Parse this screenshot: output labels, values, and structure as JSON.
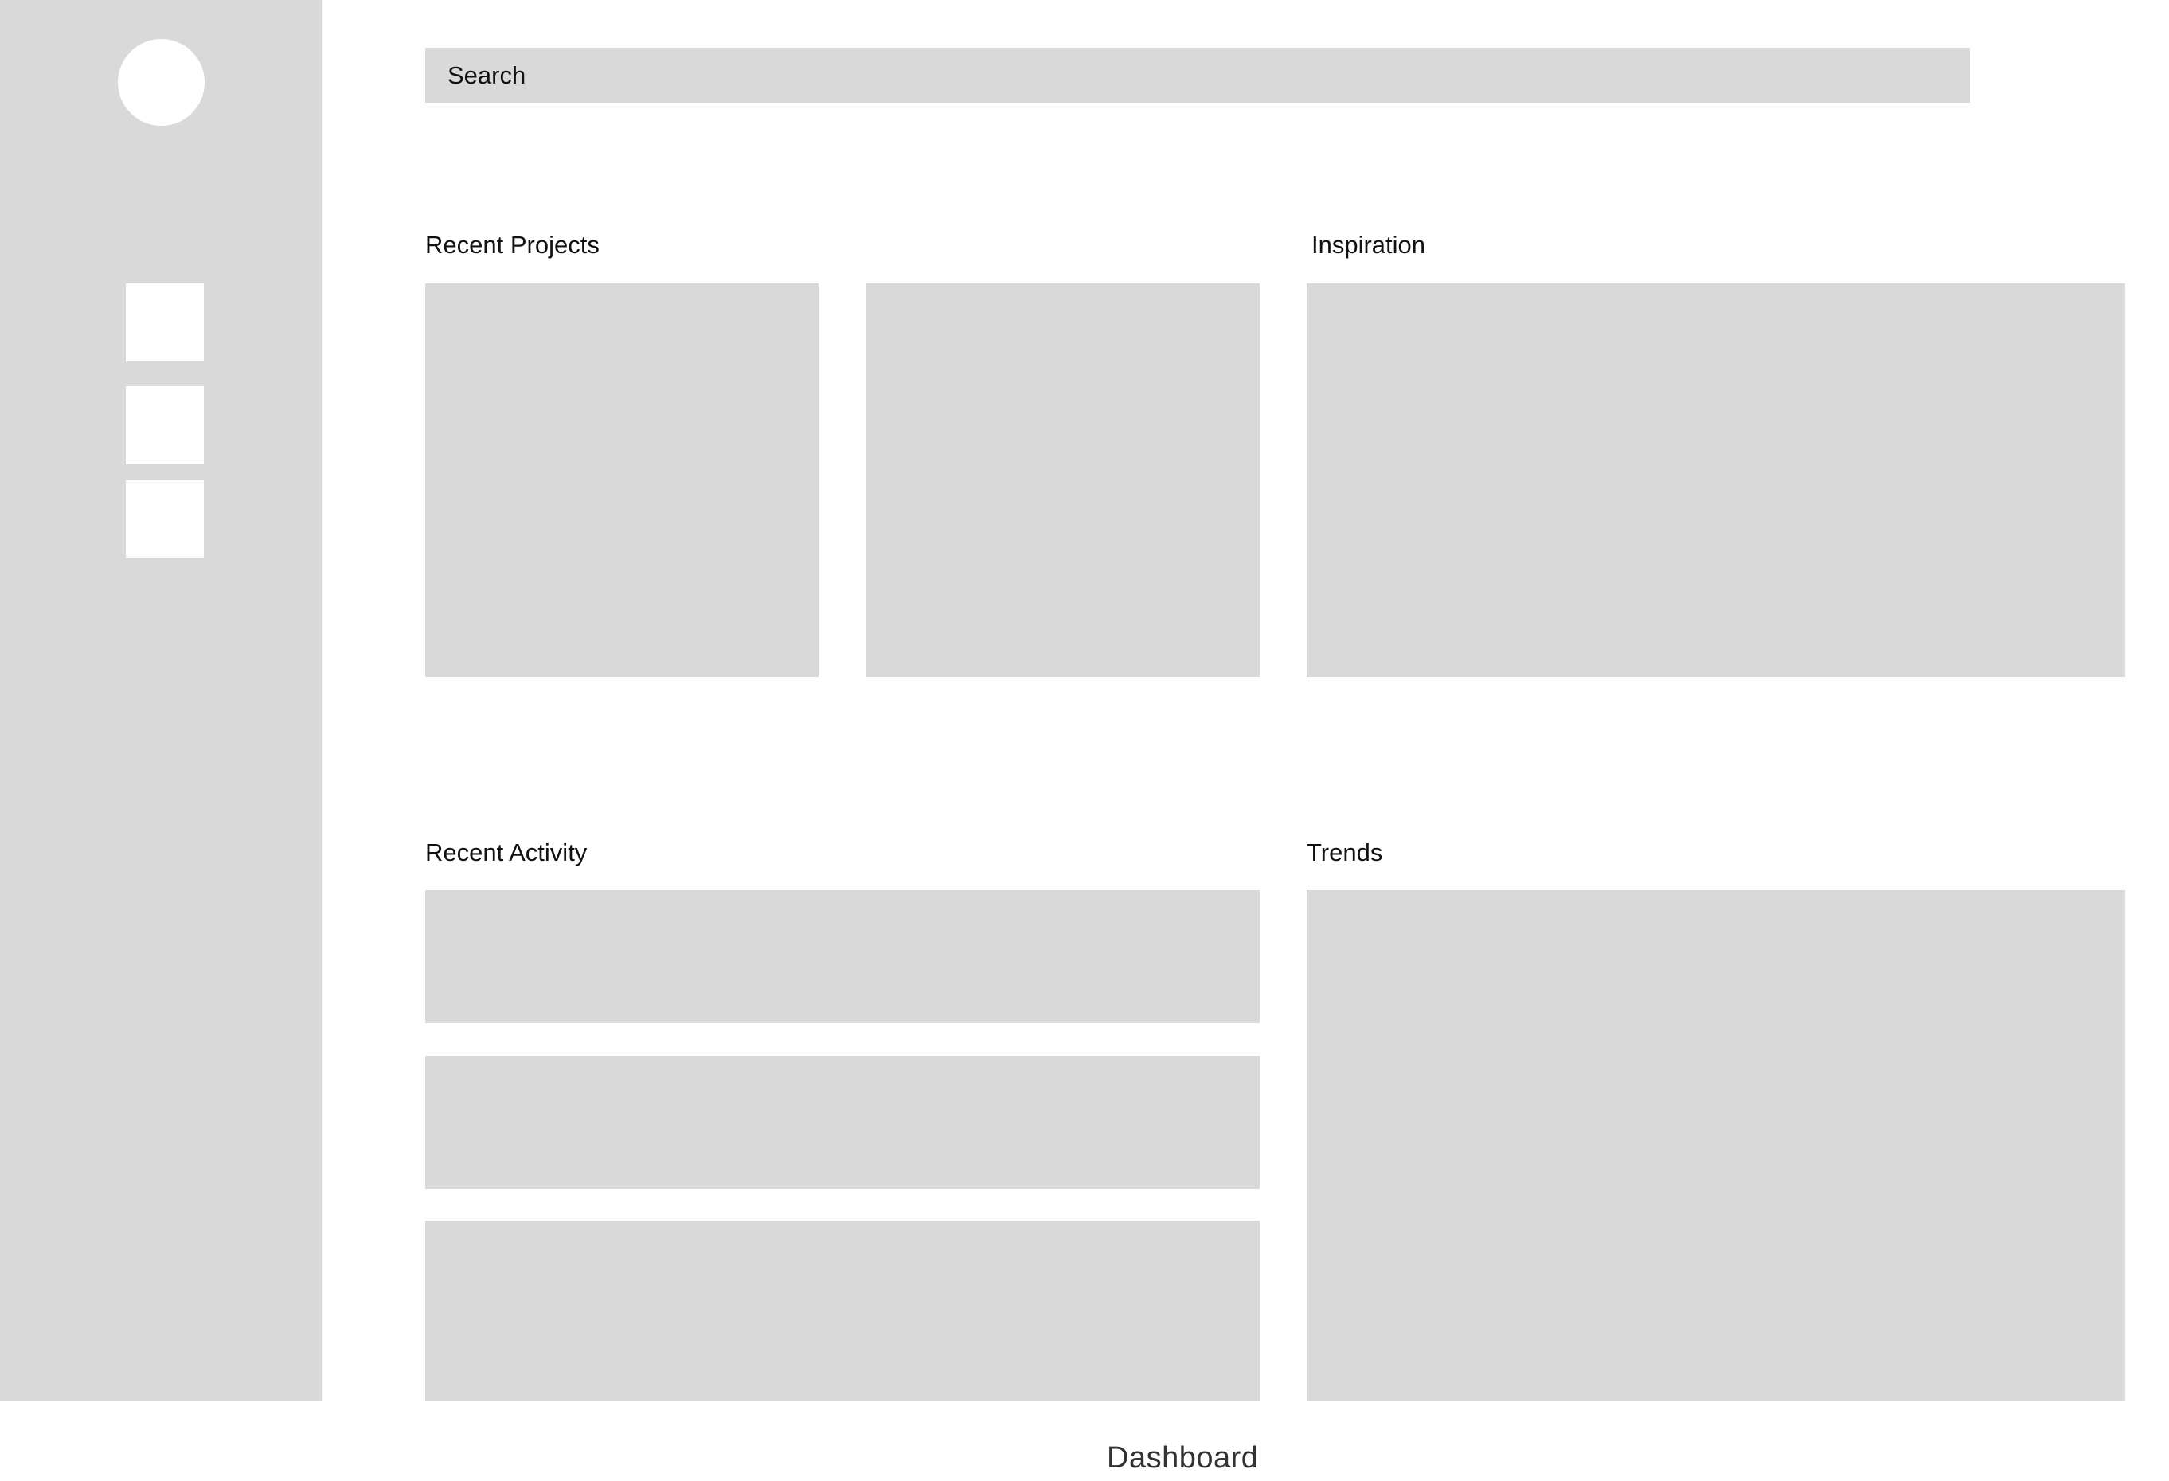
{
  "search": {
    "placeholder": "Search"
  },
  "sections": {
    "recent_projects": "Recent Projects",
    "inspiration": "Inspiration",
    "recent_activity": "Recent Activity",
    "trends": "Trends"
  },
  "footer": {
    "title": "Dashboard"
  },
  "colors": {
    "placeholder_fill": "#d9d9d9",
    "background": "#ffffff",
    "text": "#111111"
  }
}
